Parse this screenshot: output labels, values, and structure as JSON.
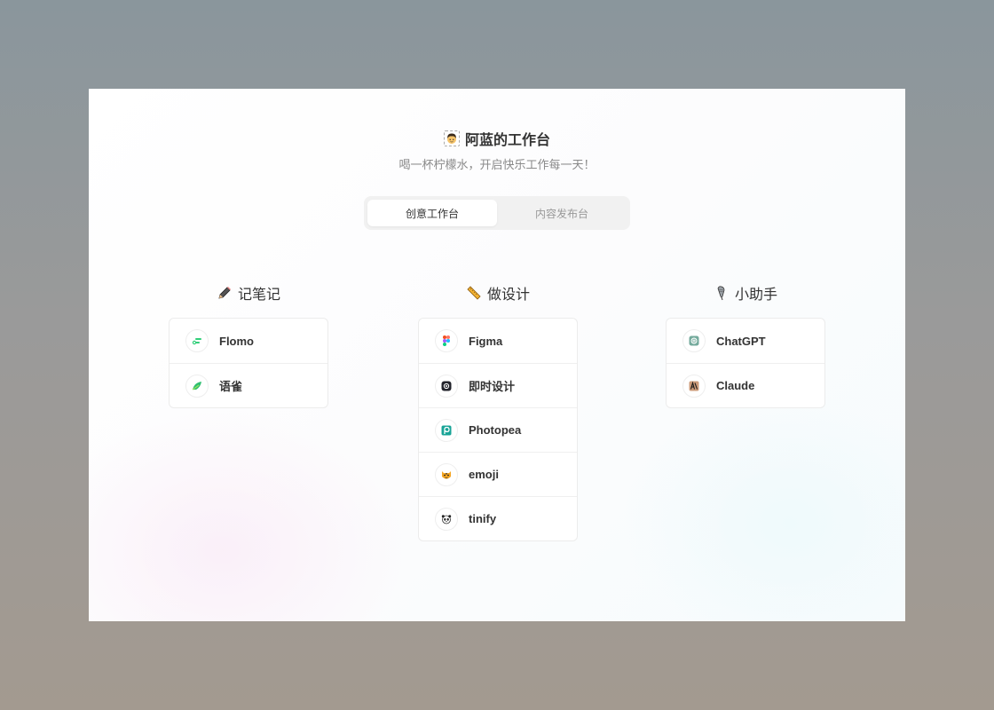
{
  "header": {
    "title": "阿蓝的工作台",
    "subtitle": "喝一杯柠檬水，开启快乐工作每一天！",
    "avatar_icon": "boy-avatar-icon"
  },
  "tabs": [
    {
      "label": "创意工作台",
      "active": true
    },
    {
      "label": "内容发布台",
      "active": false
    }
  ],
  "columns": [
    {
      "title": "记笔记",
      "icon": "pencil-icon",
      "items": [
        {
          "label": "Flomo",
          "icon": "flomo-icon"
        },
        {
          "label": "语雀",
          "icon": "yuque-icon"
        }
      ]
    },
    {
      "title": "做设计",
      "icon": "ruler-icon",
      "items": [
        {
          "label": "Figma",
          "icon": "figma-icon"
        },
        {
          "label": "即时设计",
          "icon": "jishi-icon"
        },
        {
          "label": "Photopea",
          "icon": "photopea-icon"
        },
        {
          "label": "emoji",
          "icon": "tiger-icon"
        },
        {
          "label": "tinify",
          "icon": "panda-icon"
        }
      ]
    },
    {
      "title": "小助手",
      "icon": "microphone-icon",
      "items": [
        {
          "label": "ChatGPT",
          "icon": "chatgpt-icon"
        },
        {
          "label": "Claude",
          "icon": "claude-icon"
        }
      ]
    }
  ]
}
